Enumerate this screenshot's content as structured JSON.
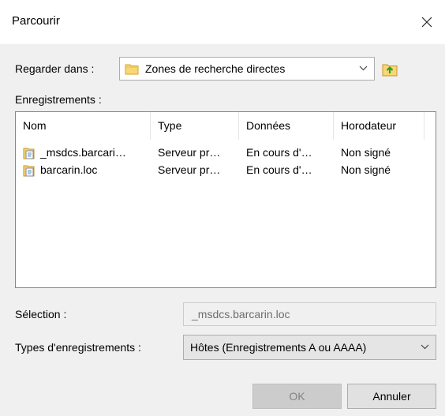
{
  "dialog": {
    "title": "Parcourir"
  },
  "look_in": {
    "label": "Regarder dans :",
    "value": "Zones de recherche directes"
  },
  "records": {
    "label": "Enregistrements :",
    "columns": [
      "Nom",
      "Type",
      "Données",
      "Horodateur"
    ],
    "rows": [
      [
        "_msdcs.barcari…",
        "Serveur pr…",
        "En cours d'…",
        "Non signé"
      ],
      [
        "barcarin.loc",
        "Serveur pr…",
        "En cours d'…",
        "Non signé"
      ]
    ]
  },
  "selection": {
    "label": "Sélection :",
    "value": "_msdcs.barcarin.loc"
  },
  "record_types": {
    "label": "Types d'enregistrements :",
    "value": "Hôtes (Enregistrements A ou AAAA)"
  },
  "buttons": {
    "ok": "OK",
    "cancel": "Annuler"
  },
  "colors": {
    "folder": "#f3c94b",
    "disabled_text": "#838383",
    "window_bg": "#f0f0f0"
  }
}
